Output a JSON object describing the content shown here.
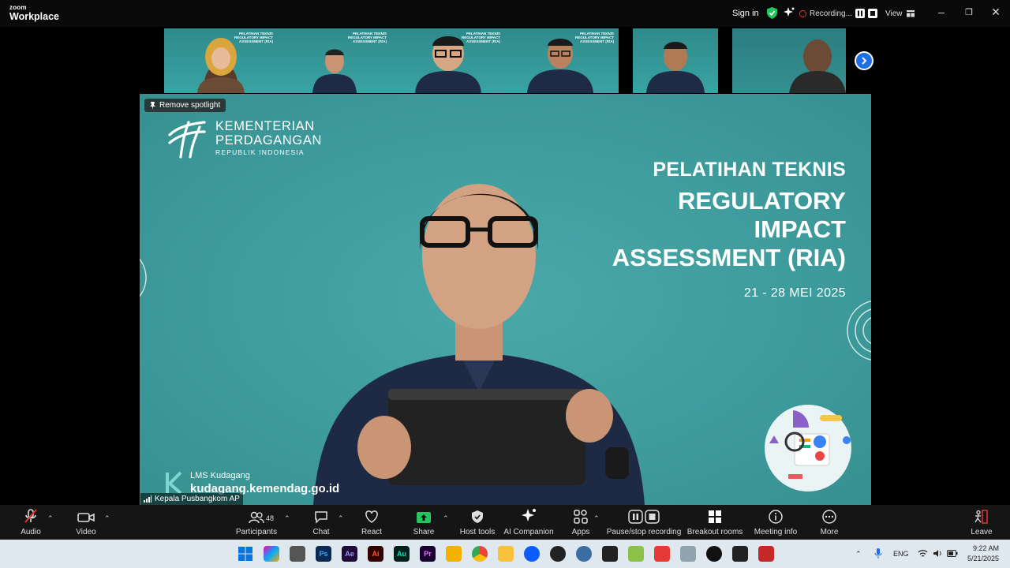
{
  "app": {
    "brand_small": "zoom",
    "brand_large": "Workplace"
  },
  "titlebar": {
    "sign_in": "Sign in",
    "recording": "Recording...",
    "view": "View"
  },
  "spotlight": {
    "remove_label": "Remove spotlight"
  },
  "slide": {
    "org_line1": "KEMENTERIAN",
    "org_line2": "PERDAGANGAN",
    "org_line3": "REPUBLIK INDONESIA",
    "heading": "PELATIHAN TEKNIS",
    "title_line1": "REGULATORY",
    "title_line2": "IMPACT",
    "title_line3": "ASSESSMENT (RIA)",
    "dates": "21 - 28 MEI 2025",
    "lms_label": "LMS Kudagang",
    "lms_url": "kudagang.kemendag.go.id"
  },
  "speaker": {
    "name": "Kepala Pusbangkom AP"
  },
  "gallery": [
    {
      "slide_text": "PELATIHAN TEKNIS REGULATORY IMPACT ASSESSMENT (RIA)"
    },
    {
      "slide_text": "PELATIHAN TEKNIS REGULATORY IMPACT ASSESSMENT (RIA)"
    },
    {
      "slide_text": "PELATIHAN TEKNIS REGULATORY IMPACT ASSESSMENT (RIA)"
    },
    {
      "slide_text": "PELATIHAN TEKNIS REGULATORY IMPACT ASSESSMENT (RIA)"
    },
    {
      "slide_text": ""
    },
    {
      "slide_text": ""
    }
  ],
  "toolbar": {
    "audio": "Audio",
    "video": "Video",
    "participants": "Participants",
    "participants_count": "48",
    "chat": "Chat",
    "react": "React",
    "share": "Share",
    "host_tools": "Host tools",
    "ai_companion": "AI Companion",
    "apps": "Apps",
    "pause_stop": "Pause/stop recording",
    "breakout": "Breakout rooms",
    "meeting_info": "Meeting info",
    "more": "More",
    "leave": "Leave"
  },
  "taskbar": {
    "lang": "ENG",
    "time": "9:22 AM",
    "date": "5/21/2025"
  },
  "colors": {
    "slide_teal": "#3f9c9d",
    "share_green": "#22c55e",
    "accent_blue": "#1e6ee8",
    "leave_red": "#e0312a"
  }
}
